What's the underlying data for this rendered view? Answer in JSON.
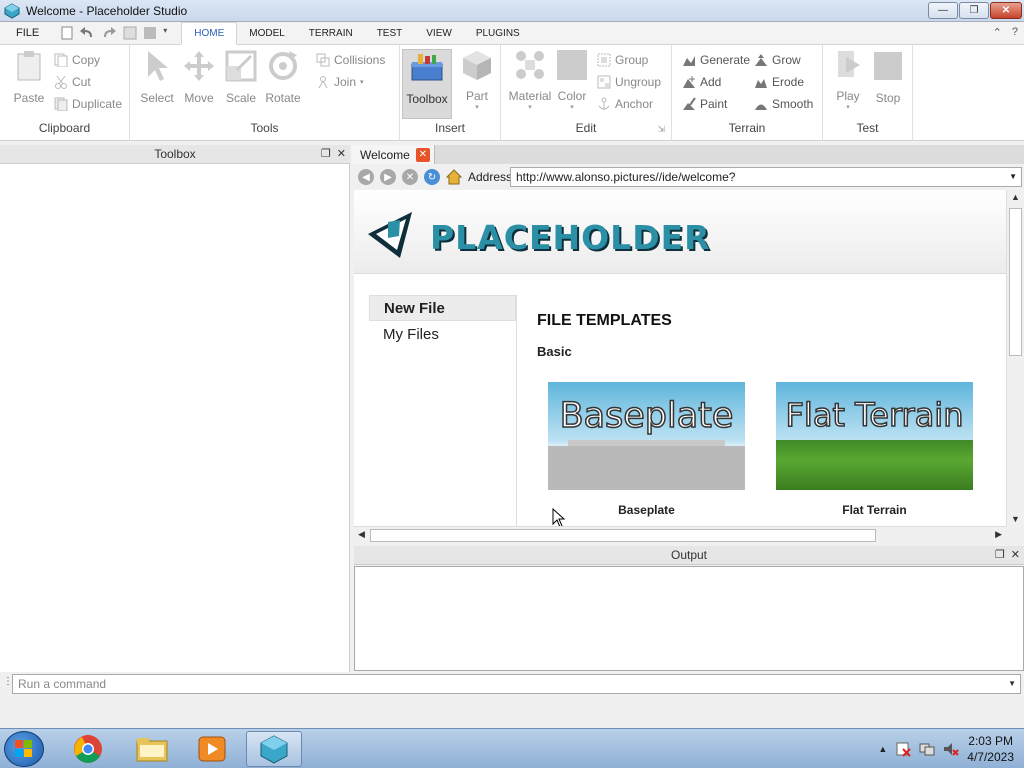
{
  "window": {
    "title": "Welcome - Placeholder Studio"
  },
  "menu": {
    "file": "FILE",
    "tabs": [
      "HOME",
      "MODEL",
      "TERRAIN",
      "TEST",
      "VIEW",
      "PLUGINS"
    ]
  },
  "ribbon": {
    "clipboard": {
      "label": "Clipboard",
      "paste": "Paste",
      "copy": "Copy",
      "cut": "Cut",
      "duplicate": "Duplicate"
    },
    "tools": {
      "label": "Tools",
      "select": "Select",
      "move": "Move",
      "scale": "Scale",
      "rotate": "Rotate",
      "collisions": "Collisions",
      "join": "Join"
    },
    "insert": {
      "label": "Insert",
      "toolbox": "Toolbox",
      "part": "Part"
    },
    "edit": {
      "label": "Edit",
      "material": "Material",
      "color": "Color",
      "group": "Group",
      "ungroup": "Ungroup",
      "anchor": "Anchor"
    },
    "terrain": {
      "label": "Terrain",
      "generate": "Generate",
      "add": "Add",
      "paint": "Paint",
      "grow": "Grow",
      "erode": "Erode",
      "smooth": "Smooth"
    },
    "test": {
      "label": "Test",
      "play": "Play",
      "stop": "Stop"
    }
  },
  "toolbox": {
    "title": "Toolbox"
  },
  "document": {
    "tab": "Welcome",
    "address_label": "Address",
    "url": "http://www.alonso.pictures//ide/welcome?"
  },
  "welcome": {
    "logo": "PLACEHOLDER",
    "nav": [
      "New File",
      "My Files"
    ],
    "heading": "FILE TEMPLATES",
    "subheading": "Basic",
    "templates": [
      {
        "caption": "Baseplate",
        "name": "Baseplate"
      },
      {
        "caption": "Flat Terrain",
        "name": "Flat Terrain"
      }
    ]
  },
  "output": {
    "title": "Output"
  },
  "command": {
    "placeholder": "Run a command"
  },
  "taskbar": {
    "time": "2:03 PM",
    "date": "4/7/2023"
  },
  "colors": {
    "accent": "#2a63b8",
    "logo": "#2b8fa5",
    "close": "#e8542a"
  }
}
